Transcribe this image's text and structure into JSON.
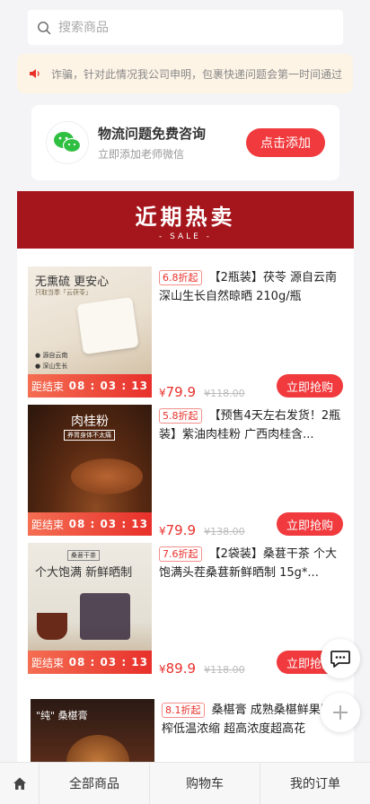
{
  "search": {
    "placeholder": "搜索商品",
    "icon": "search-icon"
  },
  "notice": {
    "icon": "speaker-icon",
    "text": "诈骗，针对此情况我公司申明，包裹快递问题会第一时间通过"
  },
  "consult": {
    "title": "物流问题免费咨询",
    "subtitle": "立即添加老师微信",
    "button": "点击添加",
    "icon": "wechat-icon"
  },
  "banner": {
    "title": "近期热卖",
    "subtitle": "- SALE -"
  },
  "colors": {
    "accent": "#f03a3d",
    "banner": "#a5161c",
    "notice_bg": "#fdf4e6"
  },
  "products": [
    {
      "discount": "6.8折起",
      "title": "【2瓶装】茯苓 源自云南深山生长自然晾晒 210g/瓶",
      "price_symbol": "¥",
      "price": "79.9",
      "original_price": "¥118.00",
      "buy_label": "立即抢购",
      "countdown_label": "距结束",
      "countdown": "08 : 03 : 13",
      "img_text_1": "无熏硫 更安心",
      "img_text_2": "只取当季「云茯苓」",
      "img_text_3": "● 源自云南",
      "img_text_4": "● 深山生长"
    },
    {
      "discount": "5.8折起",
      "title": "【预售4天左右发货！2瓶装】紫油肉桂粉 广西肉桂含...",
      "price_symbol": "¥",
      "price": "79.9",
      "original_price": "¥138.00",
      "buy_label": "立即抢购",
      "countdown_label": "距结束",
      "countdown": "08 : 03 : 13",
      "img_text_1": "肉桂粉",
      "img_text_2": "养胃身体不太痛"
    },
    {
      "discount": "7.6折起",
      "title": "【2袋装】桑葚干茶 个大饱满头茬桑葚新鲜晒制 15g*...",
      "price_symbol": "¥",
      "price": "89.9",
      "original_price": "¥118.00",
      "buy_label": "立即抢购",
      "countdown_label": "距结束",
      "countdown": "08 : 03 : 13",
      "img_text_1": "桑葚干茶",
      "img_text_2": "个大饱满 新鲜晒制"
    },
    {
      "discount": "8.1折起",
      "title": "桑椹膏 成熟桑椹鲜果压榨低温浓缩 超高浓度超高花",
      "img_text_1": "\"纯\" 桑椹膏"
    }
  ],
  "floating": {
    "chat_icon": "chat-icon",
    "plus_icon": "plus-icon"
  },
  "tabbar": {
    "home_icon": "home-icon",
    "tabs": [
      "全部商品",
      "购物车",
      "我的订单"
    ]
  }
}
